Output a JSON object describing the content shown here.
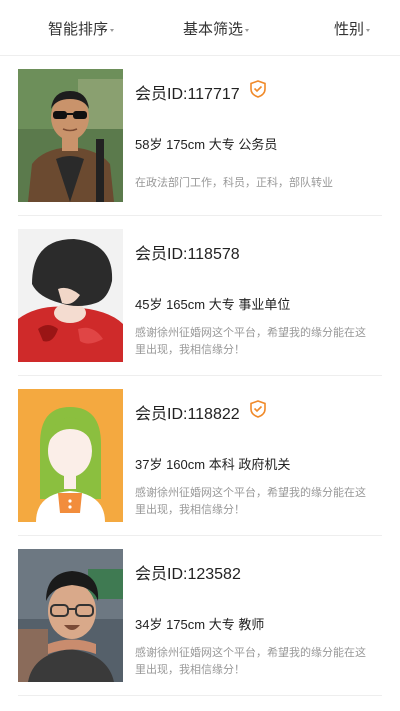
{
  "filters": [
    {
      "label": "智能排序"
    },
    {
      "label": "基本筛选"
    },
    {
      "label": "性别"
    }
  ],
  "members": [
    {
      "id_text": "会员ID:117717",
      "verified": true,
      "stats": "58岁 175cm 大专 公务员",
      "bio": "在政法部门工作，科员，正科，部队转业",
      "avatar": "photo-man-sunglasses"
    },
    {
      "id_text": "会员ID:118578",
      "verified": false,
      "stats": "45岁 165cm 大专 事业单位",
      "bio": "感谢徐州征婚网这个平台，希望我的缘分能在这里出现，我相信缘分！",
      "avatar": "photo-woman-short-hair"
    },
    {
      "id_text": "会员ID:118822",
      "verified": true,
      "stats": "37岁 160cm 本科 政府机关",
      "bio": "感谢徐州征婚网这个平台，希望我的缘分能在这里出现，我相信缘分！",
      "avatar": "female-default-avatar"
    },
    {
      "id_text": "会员ID:123582",
      "verified": false,
      "stats": "34岁 175cm 大专 教师",
      "bio": "感谢徐州征婚网这个平台，希望我的缘分能在这里出现，我相信缘分！",
      "avatar": "photo-man-glasses"
    }
  ],
  "colors": {
    "badge": "#f08a2a",
    "avatar_bg": "#f4a940",
    "divider": "#eeeeee",
    "bio_text": "#999999"
  }
}
